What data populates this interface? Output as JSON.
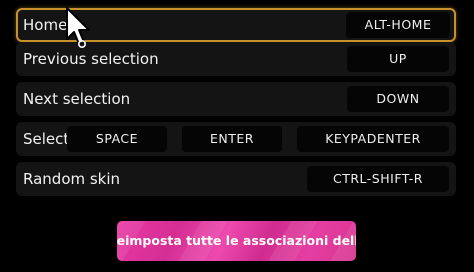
{
  "bindings": [
    {
      "label": "Home",
      "keys": [
        "ALT-HOME"
      ],
      "selected": true
    },
    {
      "label": "Previous selection",
      "keys": [
        "UP"
      ],
      "selected": false
    },
    {
      "label": "Next selection",
      "keys": [
        "DOWN"
      ],
      "selected": false
    },
    {
      "label": "Select",
      "keys": [
        "SPACE",
        "ENTER",
        "KEYPADENTER"
      ],
      "selected": false
    },
    {
      "label": "Random skin",
      "keys": [
        "CTRL-SHIFT-R"
      ],
      "selected": false
    }
  ],
  "reset_button": {
    "label": "Reimposta tutte le associazioni della sezione"
  },
  "colors": {
    "selected_border": "#c7922d",
    "reset_button": "#e23d9f"
  },
  "icons": {
    "cursor": "mouse-pointer-icon"
  }
}
